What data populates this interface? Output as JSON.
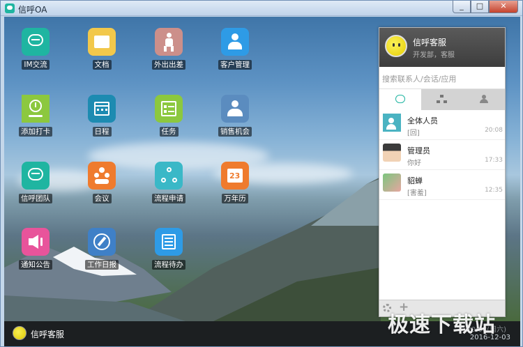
{
  "window": {
    "title": "信呼OA",
    "controls": [
      "_",
      "□",
      "✕"
    ]
  },
  "apps": [
    {
      "label": "IM交流",
      "icon": "chat-bubble-icon",
      "color": "#1fb5a1"
    },
    {
      "label": "文档",
      "icon": "folder-icon",
      "color": "#f2c84b"
    },
    {
      "label": "外出出差",
      "icon": "traveler-icon",
      "color": "#cc8f8a"
    },
    {
      "label": "客户管理",
      "icon": "customer-icon",
      "color": "#2e9be6"
    },
    {
      "label": "添加打卡",
      "icon": "clock-in-icon",
      "color": "#8cc83f"
    },
    {
      "label": "日程",
      "icon": "calendar-icon",
      "color": "#1d8bb1"
    },
    {
      "label": "任务",
      "icon": "checklist-icon",
      "color": "#8cc83f"
    },
    {
      "label": "销售机会",
      "icon": "sales-icon",
      "color": "#5b8cbf"
    },
    {
      "label": "信呼团队",
      "icon": "team-chat-icon",
      "color": "#1fb5a1"
    },
    {
      "label": "会议",
      "icon": "meeting-icon",
      "color": "#ef7b2e"
    },
    {
      "label": "流程申请",
      "icon": "workflow-icon",
      "color": "#3ab8c7"
    },
    {
      "label": "万年历",
      "icon": "perpetual-calendar-icon",
      "color": "#ef7b2e"
    },
    {
      "label": "通知公告",
      "icon": "speaker-icon",
      "color": "#e8549b"
    },
    {
      "label": "工作日报",
      "icon": "pencil-icon",
      "color": "#3f80c7"
    },
    {
      "label": "流程待办",
      "icon": "todo-list-icon",
      "color": "#2e9be6"
    }
  ],
  "panel": {
    "user_name": "信呼客服",
    "user_dept": "开发部，客服",
    "search_placeholder": "搜索联系人/会话/应用",
    "tabs": [
      "chat-tab-icon",
      "org-chart-icon",
      "contacts-icon"
    ],
    "conversations": [
      {
        "name": "全体人员",
        "message": "[回]",
        "time": "20:08"
      },
      {
        "name": "管理员",
        "message": "你好",
        "time": "17:33"
      },
      {
        "name": "貂蝉",
        "message": "[害羞]",
        "time": "12:35"
      }
    ]
  },
  "taskbar": {
    "user_name": "信呼客服",
    "time": "20:08(周六)",
    "date": "2016-12-03"
  },
  "watermark": "极速下载站"
}
